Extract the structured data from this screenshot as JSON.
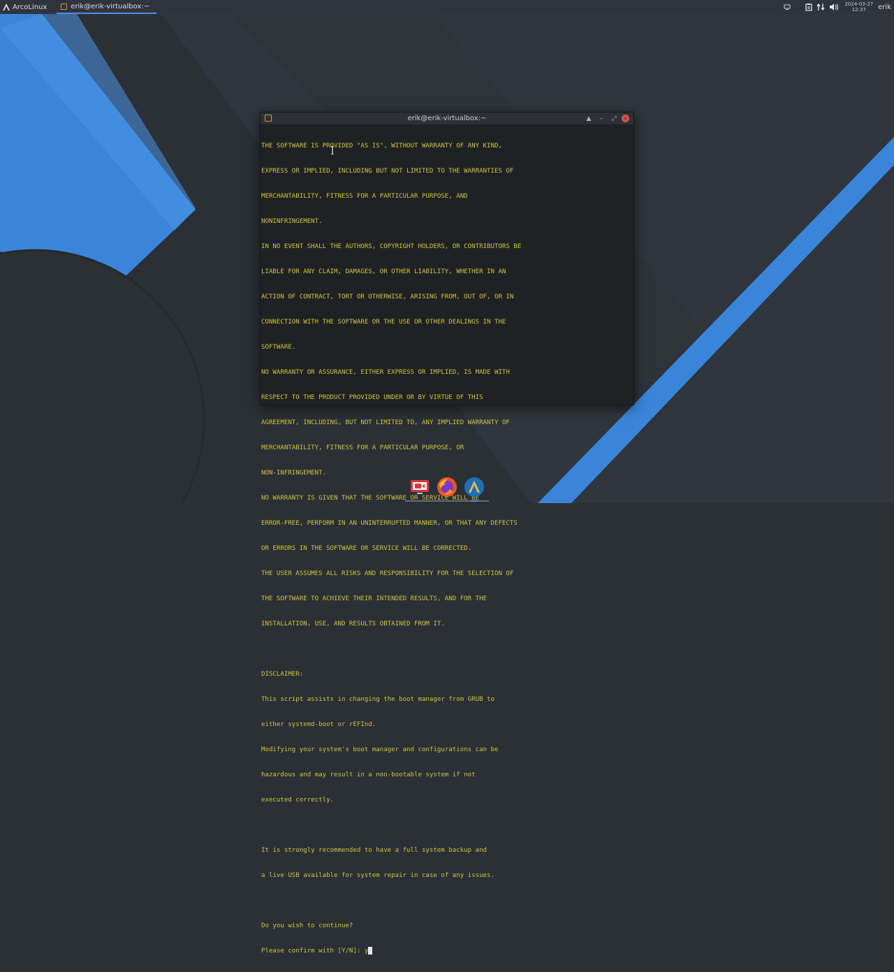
{
  "top_panel": {
    "launcher_label": "ArcoLinux",
    "launcher_icon": "arcolinux-logo-icon",
    "task_title": "erik@erik-virtualbox:~",
    "clock_date": "2024-03-27",
    "clock_time": "12:37",
    "user": "erik",
    "tray_icons": [
      "screen-icon",
      "clipboard-icon",
      "network-icon",
      "volume-icon"
    ]
  },
  "terminal": {
    "title": "erik@erik-virtualbox:~",
    "window_buttons": [
      "▲",
      "–",
      "⤢",
      "×"
    ],
    "lines": [
      "THE SOFTWARE IS PROVIDED \"AS IS\", WITHOUT WARRANTY OF ANY KIND,",
      "EXPRESS OR IMPLIED, INCLUDING BUT NOT LIMITED TO THE WARRANTIES OF",
      "MERCHANTABILITY, FITNESS FOR A PARTICULAR PURPOSE, AND",
      "NONINFRINGEMENT.",
      "IN NO EVENT SHALL THE AUTHORS, COPYRIGHT HOLDERS, OR CONTRIBUTORS BE",
      "LIABLE FOR ANY CLAIM, DAMAGES, OR OTHER LIABILITY, WHETHER IN AN",
      "ACTION OF CONTRACT, TORT OR OTHERWISE, ARISING FROM, OUT OF, OR IN",
      "CONNECTION WITH THE SOFTWARE OR THE USE OR OTHER DEALINGS IN THE",
      "SOFTWARE.",
      "NO WARRANTY OR ASSURANCE, EITHER EXPRESS OR IMPLIED, IS MADE WITH",
      "RESPECT TO THE PRODUCT PROVIDED UNDER OR BY VIRTUE OF THIS",
      "AGREEMENT, INCLUDING, BUT NOT LIMITED TO, ANY IMPLIED WARRANTY OF",
      "MERCHANTABILITY, FITNESS FOR A PARTICULAR PURPOSE, OR",
      "NON-INFRINGEMENT.",
      "NO WARRANTY IS GIVEN THAT THE SOFTWARE OR SERVICE WILL BE",
      "ERROR-FREE, PERFORM IN AN UNINTERRUPTED MANNER, OR THAT ANY DEFECTS",
      "OR ERRORS IN THE SOFTWARE OR SERVICE WILL BE CORRECTED.",
      "THE USER ASSUMES ALL RISKS AND RESPONSIBILITY FOR THE SELECTION OF",
      "THE SOFTWARE TO ACHIEVE THEIR INTENDED RESULTS, AND FOR THE",
      "INSTALLATION, USE, AND RESULTS OBTAINED FROM IT.",
      "",
      "DISCLAIMER:",
      "This script assists in changing the boot manager from GRUB to",
      "either systemd-boot or rEFInd.",
      "Modifying your system's boot manager and configurations can be",
      "hazardous and may result in a non-bootable system if not",
      "executed correctly.",
      "",
      "It is strongly recommended to have a full system backup and",
      "a live USB available for system repair in case of any issues.",
      "",
      "Do you wish to continue?"
    ],
    "prompt": "Please confirm with [Y/N]: ",
    "input_value": "y"
  },
  "dock": {
    "items": [
      {
        "name": "screen-recorder-icon",
        "color": "#d6393e"
      },
      {
        "name": "firefox-icon",
        "color": "#e8562a"
      },
      {
        "name": "arcolinux-welcome-icon",
        "color": "#1f6fb5"
      }
    ]
  },
  "colors": {
    "terminal_text": "#d0c23c",
    "accent": "#4a90e2",
    "close_button": "#d9534f"
  }
}
